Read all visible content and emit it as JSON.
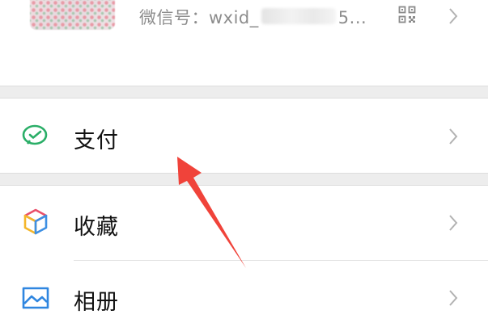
{
  "profile": {
    "wechat_id": "微信号：wxid_",
    "wechat_id_tail": "5..."
  },
  "menu": {
    "pay": {
      "label": "支付",
      "icon": "wechat-pay-icon",
      "accent": "#2aae67"
    },
    "favorites": {
      "label": "收藏",
      "icon": "favorites-cube-icon"
    },
    "album": {
      "label": "相册",
      "icon": "album-image-icon",
      "accent": "#2f86e0"
    }
  },
  "colors": {
    "background": "#ffffff",
    "separator": "#ededed",
    "secondary_text": "#8d8d8d",
    "chevron": "#b2b2b2",
    "annotation_arrow": "#f0433a"
  }
}
